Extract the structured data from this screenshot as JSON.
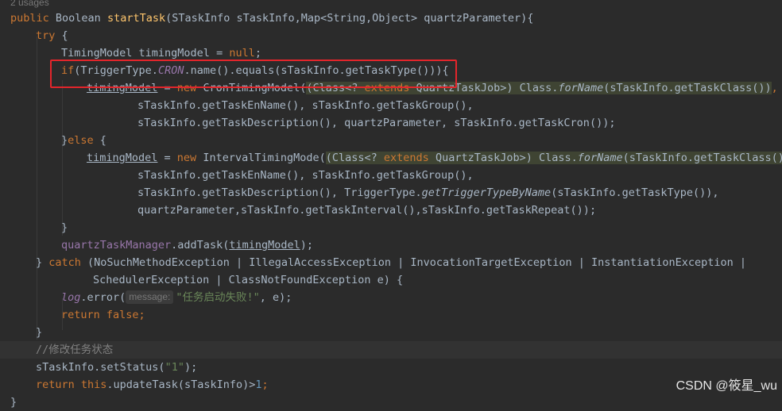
{
  "editor": {
    "usages_hint": "2 usages",
    "param_hint_label": "message:",
    "watermark": "CSDN @筱星_wu"
  },
  "code": {
    "l1": {
      "kw1": "public ",
      "type": "Boolean ",
      "method": "startTask",
      "rest": "(STaskInfo sTaskInfo,Map<String,Object> quartzParameter){"
    },
    "l2": {
      "kw": "try",
      "rest": " {"
    },
    "l3": {
      "a": "TimingModel timingModel = ",
      "kw": "null",
      "b": ";"
    },
    "l4": {
      "kw": "if",
      "a": "(TriggerType.",
      "cst": "CRON",
      "b": ".name().equals(sTaskInfo.getTaskType())){"
    },
    "l5": {
      "var": "timingModel",
      "a": " = ",
      "kw": "new ",
      "b": "CronTimingModel(",
      "c1": "(Class<? ",
      "c2": "extends ",
      "c3": "QuartzTaskJob>) Class.",
      "c4": "forName",
      "c5": "(sTaskInfo.getTaskClass())",
      "tail": ","
    },
    "l6": {
      "a": "sTaskInfo.getTaskEnName(), sTaskInfo.getTaskGroup(),"
    },
    "l7": {
      "a": "sTaskInfo.getTaskDescription(), quartzParameter, sTaskInfo.getTaskCron());"
    },
    "l8": {
      "a": "}",
      "kw": "else",
      "b": " {"
    },
    "l9": {
      "var": "timingModel",
      "a": " = ",
      "kw": "new ",
      "b": "IntervalTimingMode(",
      "c1": "(Class<? ",
      "c2": "extends ",
      "c3": "QuartzTaskJob>) Class.",
      "c4": "forName",
      "c5": "(sTaskInfo.getTaskClass())",
      "tail": ","
    },
    "l10": {
      "a": "sTaskInfo.getTaskEnName(), sTaskInfo.getTaskGroup(),"
    },
    "l11": {
      "a": "sTaskInfo.getTaskDescription(), TriggerType.",
      "it": "getTriggerTypeByName",
      "b": "(sTaskInfo.getTaskType()),"
    },
    "l12": {
      "a": "quartzParameter,sTaskInfo.getTaskInterval(),sTaskInfo.getTaskRepeat());"
    },
    "l13": {
      "a": "}"
    },
    "l14": {
      "fld": "quartzTaskManager",
      "a": ".addTask(",
      "var": "timingModel",
      "b": ");"
    },
    "l15": {
      "a": "} ",
      "kw": "catch",
      "b": " (NoSuchMethodException | IllegalAccessException | InvocationTargetException | InstantiationException |"
    },
    "l16": {
      "a": "SchedulerException | ClassNotFoundException e) {"
    },
    "l17": {
      "fld": "log",
      "a": ".error(",
      "str": "\"任务启动失败!\"",
      "b": ", e);"
    },
    "l18": {
      "kw": "return false",
      "b": ";"
    },
    "l19": {
      "a": "}"
    },
    "l20": {
      "cmt": "//修改任务状态"
    },
    "l21": {
      "a": "sTaskInfo.setStatus(",
      "str": "\"1\"",
      "b": ");"
    },
    "l22": {
      "kw1": "return ",
      "kw2": "this",
      "a": ".updateTask(sTaskInfo)>",
      "num": "1",
      "b": ";"
    },
    "l23": {
      "a": "}"
    }
  }
}
